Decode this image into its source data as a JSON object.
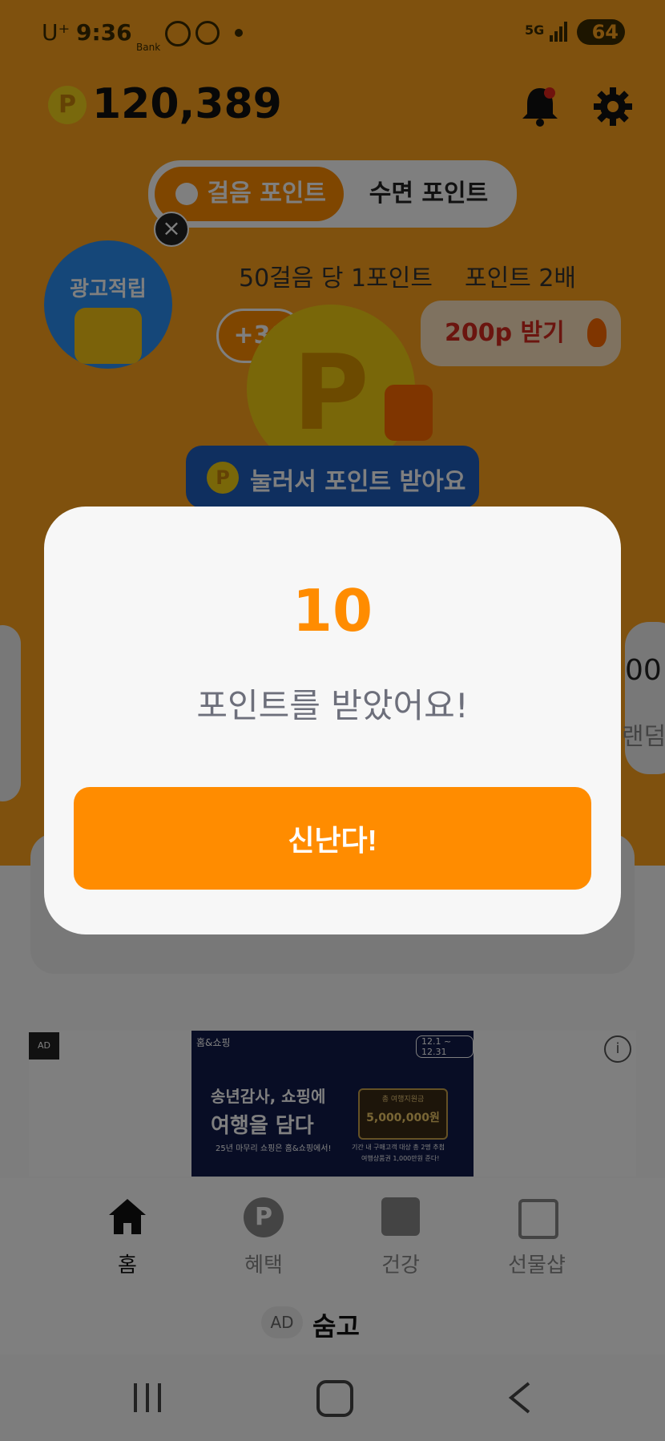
{
  "status_bar": {
    "carrier": "U⁺",
    "time": "9:36",
    "bank_label": "Bank",
    "network": "5G",
    "battery": "64"
  },
  "header": {
    "points_balance": "120,389"
  },
  "mode_tabs": [
    {
      "label": "걸음 포인트",
      "active": true
    },
    {
      "label": "수면 포인트",
      "active": false
    }
  ],
  "promo_badge": {
    "label": "광고적립"
  },
  "info": {
    "rate": "50걸음 당 1포인트",
    "double": "포인트 2배",
    "plus_badge": "+30",
    "bonus_button": "200p 받기"
  },
  "coin_tooltip": "눌러서 포인트 받아요",
  "side_fragments": {
    "number": "00",
    "label": "랜덤"
  },
  "modal": {
    "amount": "10",
    "message": "포인트를 받았어요!",
    "confirm_label": "신난다!"
  },
  "ad_banner": {
    "ad_tag": "AD",
    "brand": "홈&쇼핑",
    "period": "12.1 ~ 12.31",
    "headline_1": "송년감사, 쇼핑에",
    "headline_2": "여행을 담다",
    "sub": "25년 마무리 쇼핑은 홈&쇼핑에서!",
    "prize_label": "총 여행지원금",
    "prize_amount": "5,000,000원",
    "fine_print_1": "기간 내 구매고객 대상 총 2명 추첨",
    "fine_print_2": "여행상품권 1,000만원 준다!"
  },
  "bottom_nav": [
    {
      "label": "홈",
      "icon": "home-icon"
    },
    {
      "label": "혜택",
      "icon": "point-icon"
    },
    {
      "label": "건강",
      "icon": "chart-icon"
    },
    {
      "label": "선물샵",
      "icon": "bag-icon"
    }
  ],
  "footer_ad": {
    "tag": "AD",
    "text": "숨고"
  },
  "colors": {
    "accent": "#ff8c00",
    "app_bg": "#ffa21d",
    "modal_bg": "#f7f7f7"
  }
}
